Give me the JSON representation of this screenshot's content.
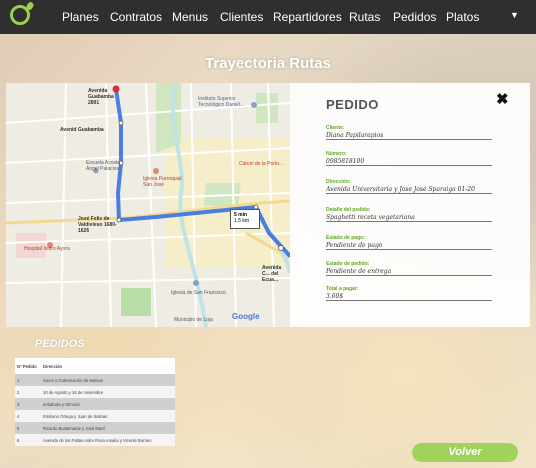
{
  "nav": {
    "items": [
      "Planes",
      "Contratos",
      "Menus",
      "Clientes",
      "Repartidores",
      "Rutas",
      "Pedidos",
      "Platos"
    ]
  },
  "page_title": "Trayectoria Rutas",
  "map": {
    "labels": {
      "start": "Avenida Guabamba 2891",
      "guabamba": "Avenid Guabamba",
      "instituto": "Instituto Superior Tecnológico Daniel...",
      "escuela": "Escuela Acosta Ángel Palacios",
      "iglesia_red": "Iglesia Parroquial San José",
      "carcel": "Cárcel de la Porto...",
      "jose_felix": "José Felix de Valdivieso 1680-1626",
      "hospital": "Hospital Isidro Ayora",
      "av_end": "Avenida C... del Ecua...",
      "iglesia_sf": "Iglesia de San Francisco",
      "municipio": "Municipio de Loja",
      "time": "5 min",
      "time_sub": "1.5 km"
    },
    "google": "Google"
  },
  "pedido": {
    "title": "PEDIDO",
    "fields": [
      {
        "label": "Cliente:",
        "value": "Diana Papilarapios"
      },
      {
        "label": "Número:",
        "value": "0985818100"
      },
      {
        "label": "Dirección:",
        "value": "Avenida Universitaria y Jose José Sparaiga 01-20"
      },
      {
        "label": "Detalle del pedido:",
        "value": "Spaghetti receta vegetariana"
      },
      {
        "label": "Estado de pago:",
        "value": "Pendiente de pago"
      },
      {
        "label": "Estado de pedido:",
        "value": "Pendiente de entrega"
      },
      {
        "label": "Total a pagar:",
        "value": "3.60$"
      }
    ]
  },
  "pedidos": {
    "title": "PEDIDOS",
    "columns": [
      "Nº Pedido",
      "Dirección"
    ],
    "rows": [
      {
        "n": "1",
        "dir": "Sucre y Gobernación de Mainas"
      },
      {
        "n": "2",
        "dir": "10 de Agosto y 18 de noviembre"
      },
      {
        "n": "3",
        "dir": "Imbabura y Olmedo"
      },
      {
        "n": "4",
        "dir": "Emiliano Ortega y Juan de Salinas"
      },
      {
        "n": "5",
        "dir": "Ricardo Bustamante y José Martí"
      },
      {
        "n": "6",
        "dir": "Avenida de los Paltas entre Rosa Amalia y Vicente Burneo"
      }
    ]
  },
  "volver_label": "Volver",
  "colors": {
    "accent": "#9fd35c",
    "navbar": "#2f2f2f",
    "route": "#4a7ee0"
  }
}
